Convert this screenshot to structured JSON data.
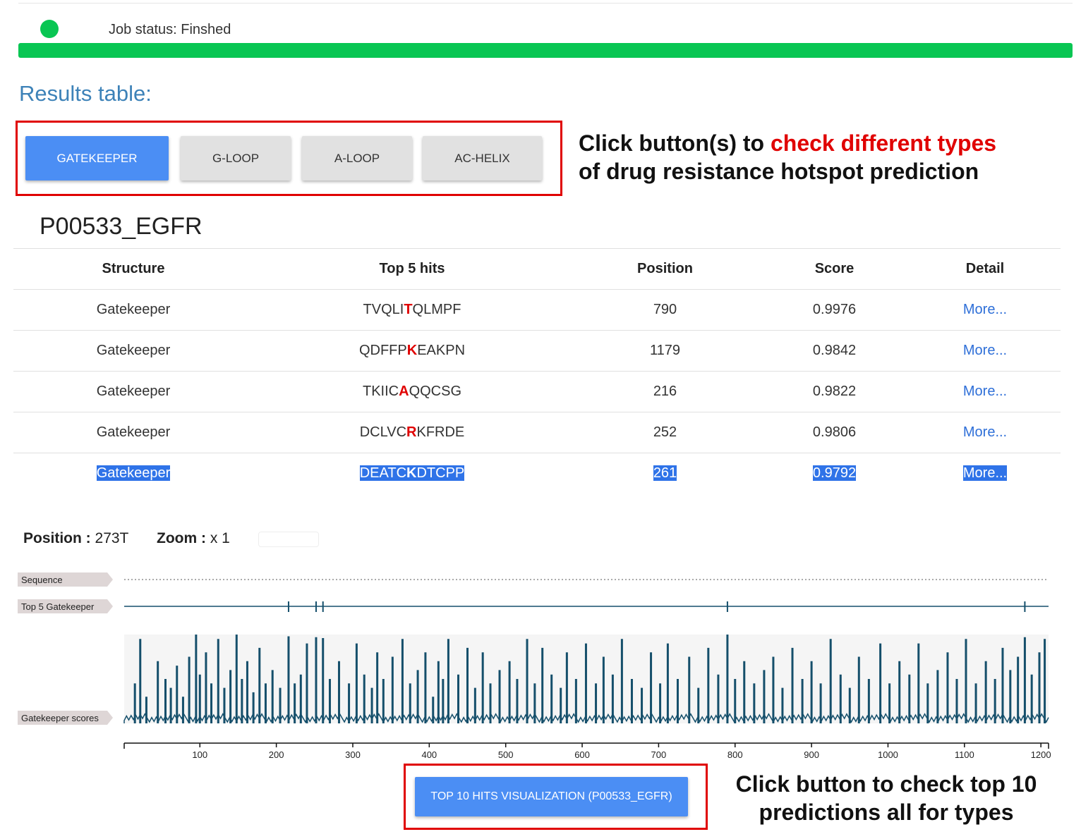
{
  "job": {
    "status_text": "Job status: Finshed",
    "progress": 1.0,
    "status_color": "#09c653"
  },
  "results_title": "Results table:",
  "tabs": [
    {
      "label": "GATEKEEPER",
      "active": true
    },
    {
      "label": "G-LOOP",
      "active": false
    },
    {
      "label": "A-LOOP",
      "active": false
    },
    {
      "label": "AC-HELIX",
      "active": false
    }
  ],
  "callouts": {
    "tabs": {
      "pre": "Click button(s) to ",
      "highlight": "check different types",
      "line2": "of drug resistance hotspot prediction"
    },
    "viz": {
      "line1": "Click button to check top 10",
      "line2": "predictions all for types"
    }
  },
  "protein": "P00533_EGFR",
  "table": {
    "headers": [
      "Structure",
      "Top 5 hits",
      "Position",
      "Score",
      "Detail"
    ],
    "rows": [
      {
        "structure": "Gatekeeper",
        "hit_pre": "TVQLI",
        "hit_res": "T",
        "hit_post": "QLMPF",
        "position": "790",
        "score": "0.9976",
        "detail": "More..."
      },
      {
        "structure": "Gatekeeper",
        "hit_pre": "QDFFP",
        "hit_res": "K",
        "hit_post": "EAKPN",
        "position": "1179",
        "score": "0.9842",
        "detail": "More..."
      },
      {
        "structure": "Gatekeeper",
        "hit_pre": "TKIIC",
        "hit_res": "A",
        "hit_post": "QQCSG",
        "position": "216",
        "score": "0.9822",
        "detail": "More..."
      },
      {
        "structure": "Gatekeeper",
        "hit_pre": "DCLVC",
        "hit_res": "R",
        "hit_post": "KFRDE",
        "position": "252",
        "score": "0.9806",
        "detail": "More..."
      },
      {
        "structure": "Gatekeeper",
        "hit_pre": "DEATC",
        "hit_res": "K",
        "hit_post": "DTCPP",
        "position": "261",
        "score": "0.9792",
        "detail": "More...",
        "selected": true
      }
    ]
  },
  "viewer": {
    "position_label": "Position :",
    "position_value": "273T",
    "zoom_label": "Zoom :",
    "zoom_value": "x 1",
    "tracks": [
      "Sequence",
      "Top 5 Gatekeeper",
      "Gatekeeper scores"
    ],
    "hit_positions": [
      216,
      252,
      261,
      790,
      1179
    ],
    "axis": {
      "min": 1,
      "max": 1210,
      "ticks": [
        100,
        200,
        300,
        400,
        500,
        600,
        700,
        800,
        900,
        1000,
        1100,
        1200
      ]
    },
    "bar_color": "#154f6b",
    "score_spikes": [
      [
        15,
        0.45
      ],
      [
        22,
        0.95
      ],
      [
        30,
        0.3
      ],
      [
        45,
        0.7
      ],
      [
        55,
        0.5
      ],
      [
        62,
        0.4
      ],
      [
        70,
        0.65
      ],
      [
        78,
        0.3
      ],
      [
        86,
        0.75
      ],
      [
        95,
        1.0
      ],
      [
        100,
        0.55
      ],
      [
        108,
        0.8
      ],
      [
        115,
        0.45
      ],
      [
        124,
        0.95
      ],
      [
        132,
        0.4
      ],
      [
        140,
        0.6
      ],
      [
        148,
        1.0
      ],
      [
        155,
        0.5
      ],
      [
        162,
        0.7
      ],
      [
        170,
        0.35
      ],
      [
        178,
        0.85
      ],
      [
        186,
        0.45
      ],
      [
        195,
        0.6
      ],
      [
        205,
        0.4
      ],
      [
        216,
        0.98
      ],
      [
        224,
        0.45
      ],
      [
        232,
        0.55
      ],
      [
        240,
        0.9
      ],
      [
        252,
        0.97
      ],
      [
        261,
        0.96
      ],
      [
        270,
        0.5
      ],
      [
        282,
        0.7
      ],
      [
        295,
        0.45
      ],
      [
        305,
        0.9
      ],
      [
        315,
        0.55
      ],
      [
        325,
        0.4
      ],
      [
        332,
        0.8
      ],
      [
        340,
        0.5
      ],
      [
        352,
        0.75
      ],
      [
        365,
        0.95
      ],
      [
        375,
        0.45
      ],
      [
        385,
        0.6
      ],
      [
        395,
        0.8
      ],
      [
        405,
        0.3
      ],
      [
        412,
        0.7
      ],
      [
        418,
        0.5
      ],
      [
        425,
        0.95
      ],
      [
        438,
        0.55
      ],
      [
        450,
        0.85
      ],
      [
        460,
        0.4
      ],
      [
        470,
        0.8
      ],
      [
        480,
        0.45
      ],
      [
        492,
        0.6
      ],
      [
        505,
        0.7
      ],
      [
        515,
        0.5
      ],
      [
        528,
        0.95
      ],
      [
        538,
        0.45
      ],
      [
        548,
        0.85
      ],
      [
        560,
        0.55
      ],
      [
        572,
        0.4
      ],
      [
        580,
        0.8
      ],
      [
        592,
        0.5
      ],
      [
        605,
        0.9
      ],
      [
        618,
        0.45
      ],
      [
        628,
        0.75
      ],
      [
        640,
        0.55
      ],
      [
        652,
        0.95
      ],
      [
        665,
        0.5
      ],
      [
        678,
        0.4
      ],
      [
        690,
        0.8
      ],
      [
        702,
        0.45
      ],
      [
        712,
        0.9
      ],
      [
        725,
        0.5
      ],
      [
        740,
        0.75
      ],
      [
        752,
        0.4
      ],
      [
        765,
        0.85
      ],
      [
        778,
        0.55
      ],
      [
        790,
        1.0
      ],
      [
        800,
        0.5
      ],
      [
        812,
        0.7
      ],
      [
        825,
        0.45
      ],
      [
        838,
        0.6
      ],
      [
        850,
        0.75
      ],
      [
        862,
        0.4
      ],
      [
        875,
        0.85
      ],
      [
        888,
        0.5
      ],
      [
        900,
        0.7
      ],
      [
        912,
        0.45
      ],
      [
        925,
        0.95
      ],
      [
        938,
        0.55
      ],
      [
        950,
        0.4
      ],
      [
        962,
        0.75
      ],
      [
        975,
        0.5
      ],
      [
        990,
        0.9
      ],
      [
        1002,
        0.45
      ],
      [
        1015,
        0.7
      ],
      [
        1028,
        0.55
      ],
      [
        1040,
        0.9
      ],
      [
        1052,
        0.45
      ],
      [
        1065,
        0.6
      ],
      [
        1078,
        0.8
      ],
      [
        1090,
        0.5
      ],
      [
        1102,
        0.95
      ],
      [
        1115,
        0.45
      ],
      [
        1128,
        0.7
      ],
      [
        1140,
        0.5
      ],
      [
        1150,
        0.85
      ],
      [
        1160,
        0.6
      ],
      [
        1170,
        0.75
      ],
      [
        1179,
        0.97
      ],
      [
        1188,
        0.55
      ],
      [
        1198,
        0.8
      ],
      [
        1205,
        0.95
      ]
    ]
  },
  "viz_button_label": "TOP 10 HITS VISUALIZATION (P00533_EGFR)"
}
